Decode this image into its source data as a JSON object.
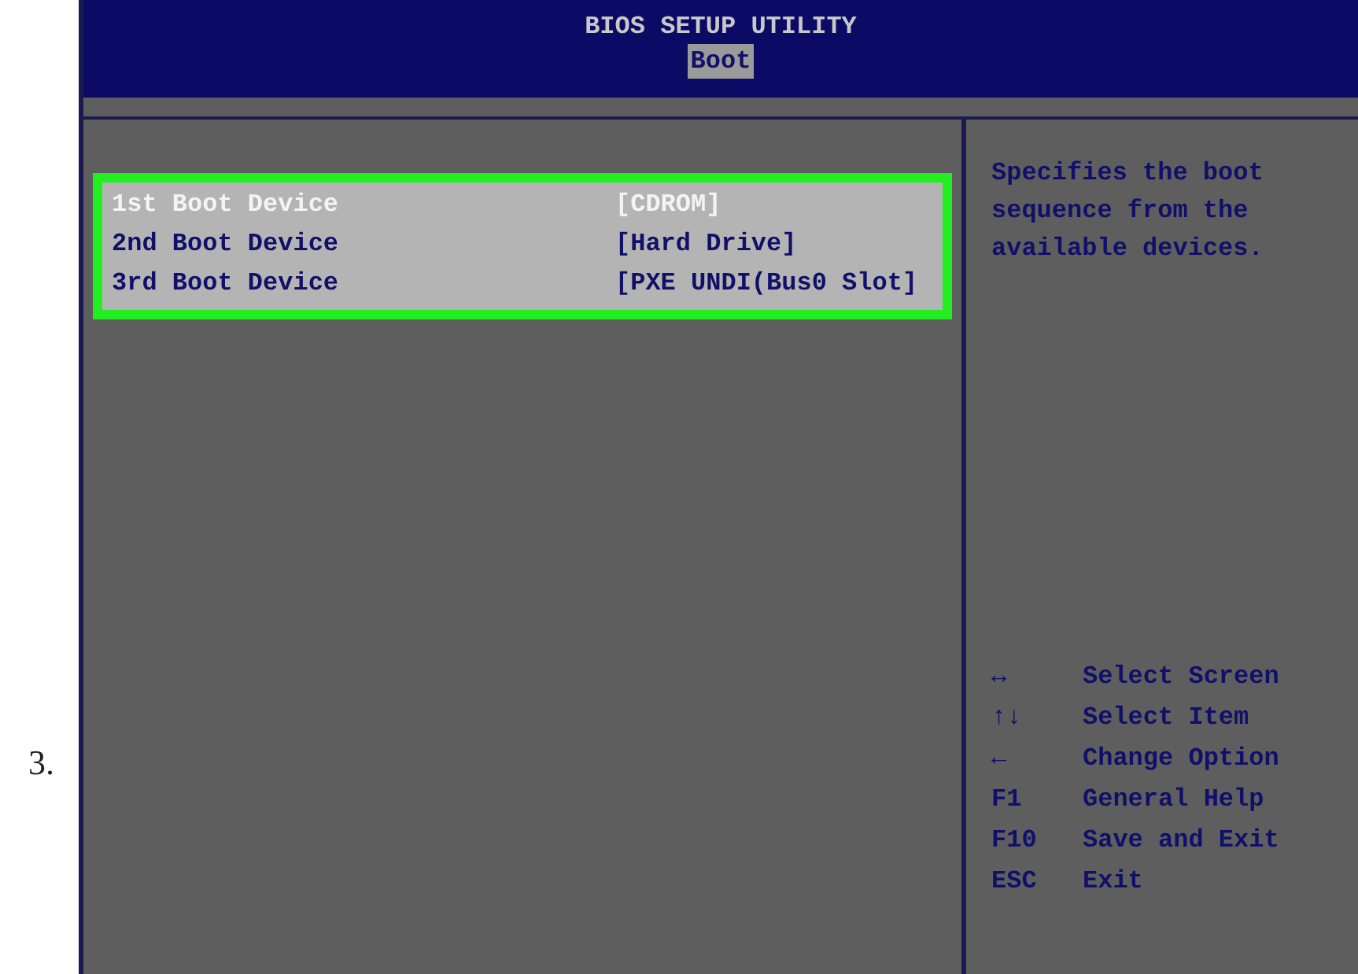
{
  "step_number": "3.",
  "window": {
    "title": "BIOS SETUP UTILITY"
  },
  "tabs": [
    {
      "label": "Boot",
      "selected": true
    }
  ],
  "boot_devices": [
    {
      "label": "1st Boot Device",
      "value": "[CDROM]",
      "selected": true
    },
    {
      "label": "2nd Boot Device",
      "value": "[Hard Drive]",
      "selected": false
    },
    {
      "label": "3rd Boot Device",
      "value": "[PXE UNDI(Bus0 Slot]",
      "selected": false
    }
  ],
  "help_text": "Specifies the boot sequence from the available devices.",
  "key_legend": [
    {
      "key": "↔",
      "action": "Select Screen"
    },
    {
      "key": "↑↓",
      "action": "Select Item"
    },
    {
      "key": "←",
      "action": "Change Option"
    },
    {
      "key": "F1",
      "action": "General Help"
    },
    {
      "key": "F10",
      "action": "Save and Exit"
    },
    {
      "key": "ESC",
      "action": "Exit"
    }
  ]
}
